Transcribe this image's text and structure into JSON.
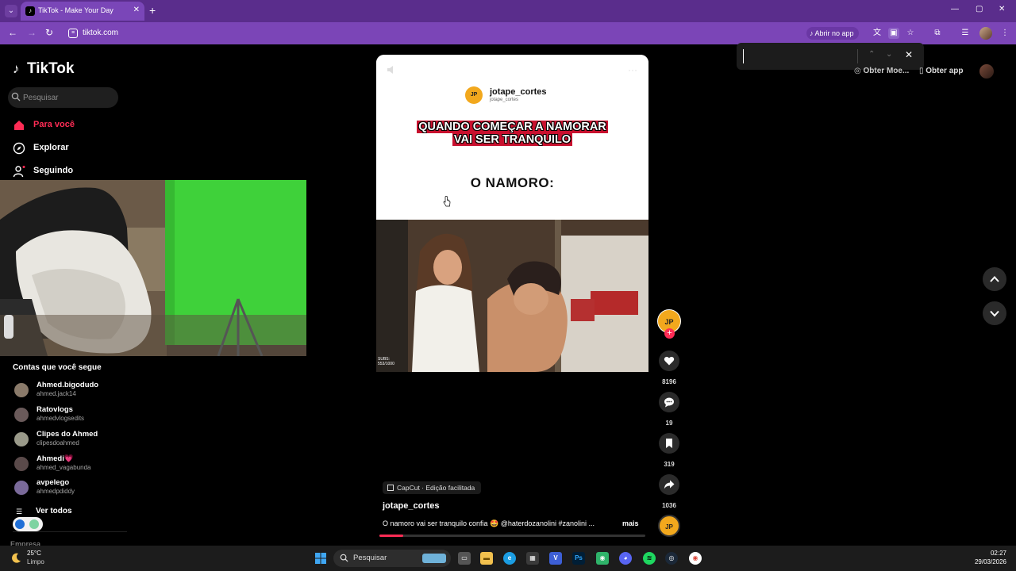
{
  "browser": {
    "tab_title": "TikTok - Make Your Day",
    "url": "tiktok.com",
    "open_app_label": "Abrir no app"
  },
  "sidebar": {
    "logo": "TikTok",
    "search_placeholder": "Pesquisar",
    "nav": [
      {
        "label": "Para você",
        "icon": "home-icon",
        "active": true
      },
      {
        "label": "Explorar",
        "icon": "compass-icon",
        "active": false
      },
      {
        "label": "Seguindo",
        "icon": "following-icon",
        "active": false
      }
    ],
    "following_title": "Contas que você segue",
    "accounts": [
      {
        "name": "Ahmed.bigodudo",
        "handle": "ahmed.jack14",
        "color": "#8a7a6a"
      },
      {
        "name": "Ratovlogs",
        "handle": "ahmedvlogsedits",
        "color": "#6a5a5a"
      },
      {
        "name": "Clipes do Ahmed",
        "handle": "clipesdoahmed",
        "color": "#9a9a8a"
      },
      {
        "name": "Ahmedi",
        "badge": "💗",
        "handle": "ahmed_vagabunda",
        "color": "#5a4a4a"
      },
      {
        "name": "avpelego",
        "handle": "ahmedpdiddy",
        "color": "#7a6a9a"
      }
    ],
    "see_all": "Ver todos",
    "footer": "Empresa"
  },
  "video": {
    "channel": "jotape_cortes",
    "channel_handle": "jotape_cortes",
    "logo_text": "JP",
    "caption_line1": "QUANDO COMEÇAR A NAMORAR",
    "caption_line2": "VAI SER TRANQUILO",
    "heading": "O NAMORO:",
    "subs_label": "SUBS:",
    "subs_value": "553/1000"
  },
  "actions": {
    "likes": "8196",
    "comments": "19",
    "saves": "319",
    "shares": "1036",
    "creator_initials": "JP"
  },
  "info": {
    "capcut": "CapCut · Edição facilitada",
    "author": "jotape_cortes",
    "description": "O namoro vai ser tranquilo confia 🤩 @haterdozanolini #zanolini ...",
    "more": "mais",
    "progress": 0.09
  },
  "top_right": {
    "coins": "Obter Moe...",
    "get_app": "Obter app"
  },
  "taskbar": {
    "temp": "25°C",
    "condition": "Limpo",
    "search": "Pesquisar",
    "time": "02:27",
    "date": "29/03/2026"
  },
  "colors": {
    "accent": "#fe2c55",
    "browser_tabbar": "#5a2d8c",
    "browser_toolbar": "#7b45b7",
    "caption_red": "#c8102e",
    "jp_orange": "#f2a81d"
  }
}
